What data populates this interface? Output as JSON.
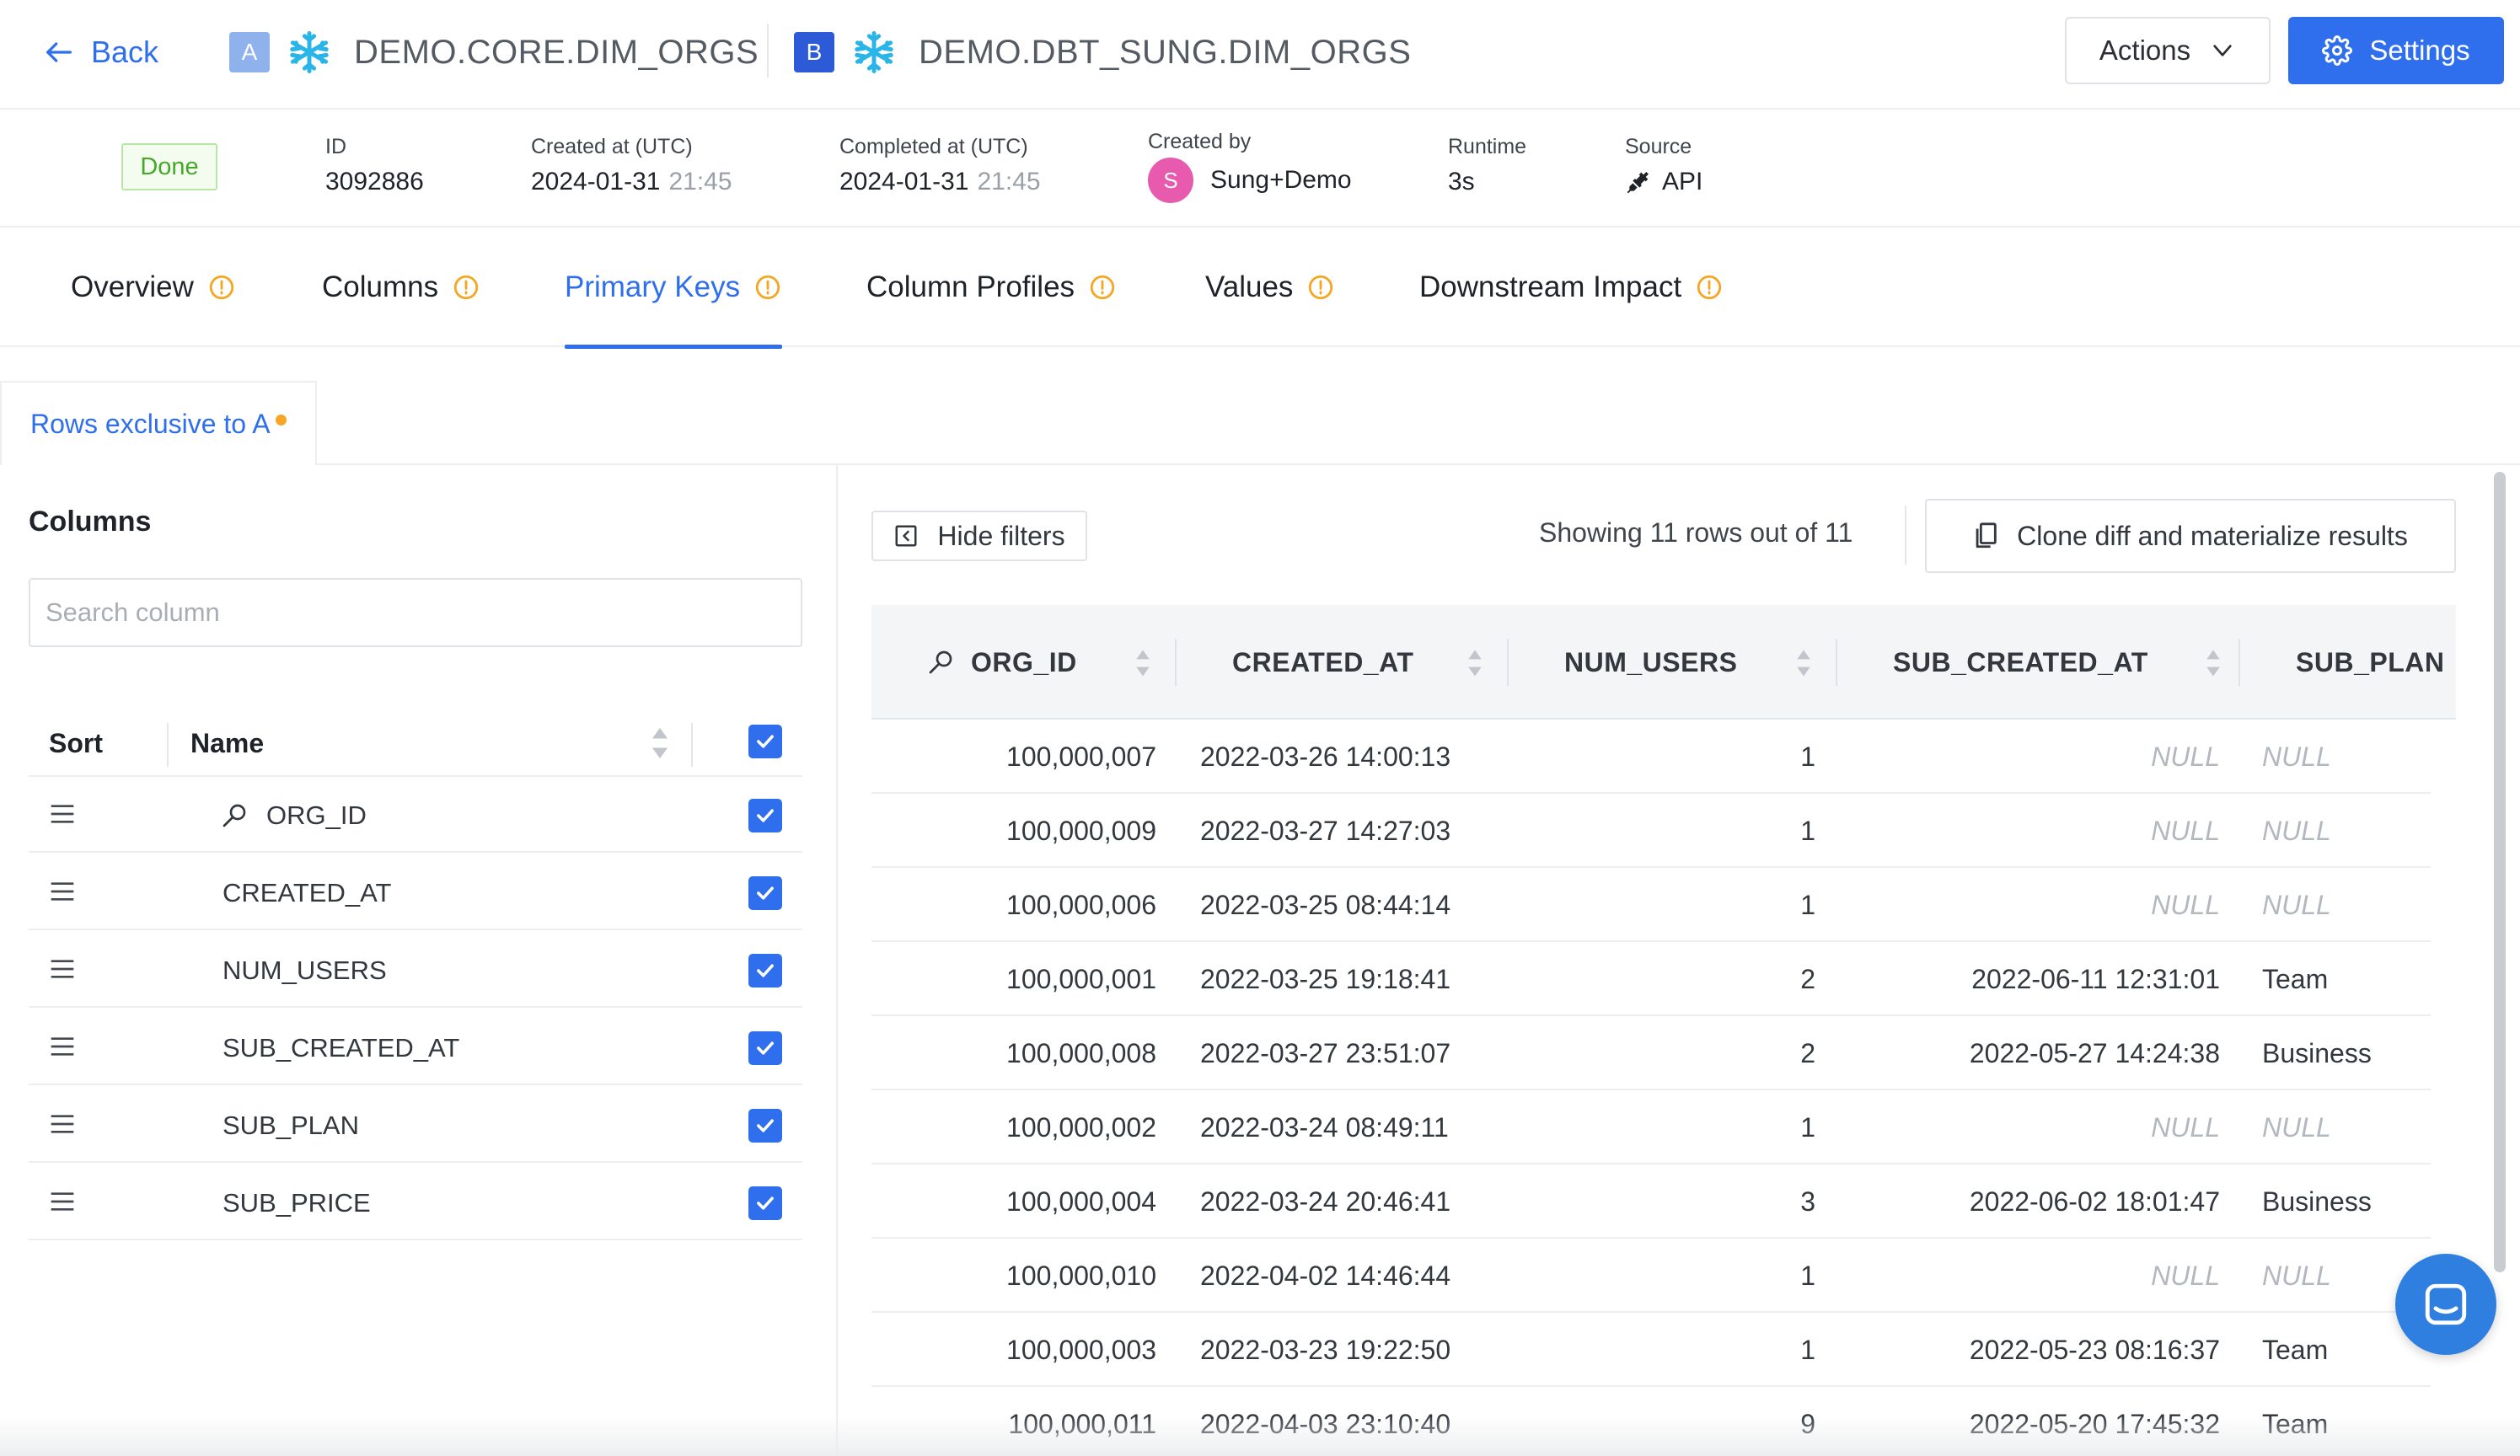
{
  "header": {
    "back_label": "Back",
    "dataset_a": {
      "badge": "A",
      "name": "DEMO.CORE.DIM_ORGS"
    },
    "dataset_b": {
      "badge": "B",
      "name": "DEMO.DBT_SUNG.DIM_ORGS"
    },
    "actions_label": "Actions",
    "settings_label": "Settings",
    "colors": {
      "accent": "#2f6fed",
      "badge_a": "#8fb1ec",
      "badge_b": "#2d5bd8",
      "snowflake": "#29b5e8"
    }
  },
  "meta": {
    "status": "Done",
    "id_label": "ID",
    "id_value": "3092886",
    "created_label": "Created at (UTC)",
    "created_date": "2024-01-31",
    "created_time": "21:45",
    "completed_label": "Completed at (UTC)",
    "completed_date": "2024-01-31",
    "completed_time": "21:45",
    "created_by_label": "Created by",
    "avatar_initial": "S",
    "created_by": "Sung+Demo",
    "runtime_label": "Runtime",
    "runtime_value": "3s",
    "source_label": "Source",
    "source_value": "API"
  },
  "tabs": [
    {
      "label": "Overview",
      "active": false
    },
    {
      "label": "Columns",
      "active": false
    },
    {
      "label": "Primary Keys",
      "active": true
    },
    {
      "label": "Column Profiles",
      "active": false
    },
    {
      "label": "Values",
      "active": false
    },
    {
      "label": "Downstream Impact",
      "active": false
    }
  ],
  "subtab": {
    "label": "Rows exclusive to A"
  },
  "columns_panel": {
    "title": "Columns",
    "search_placeholder": "Search column",
    "sort_header": "Sort",
    "name_header": "Name",
    "items": [
      {
        "name": "ORG_ID",
        "is_key": true,
        "checked": true
      },
      {
        "name": "CREATED_AT",
        "is_key": false,
        "checked": true
      },
      {
        "name": "NUM_USERS",
        "is_key": false,
        "checked": true
      },
      {
        "name": "SUB_CREATED_AT",
        "is_key": false,
        "checked": true
      },
      {
        "name": "SUB_PLAN",
        "is_key": false,
        "checked": true
      },
      {
        "name": "SUB_PRICE",
        "is_key": false,
        "checked": true
      }
    ]
  },
  "results": {
    "hide_filters_label": "Hide filters",
    "showing_text": "Showing 11 rows out of 11",
    "clone_label": "Clone diff and materialize results",
    "headers": [
      "ORG_ID",
      "CREATED_AT",
      "NUM_USERS",
      "SUB_CREATED_AT",
      "SUB_PLAN"
    ],
    "rows": [
      {
        "org_id": "100,000,007",
        "created_at": "2022-03-26 14:00:13",
        "num_users": "1",
        "sub_created_at": "NULL",
        "sub_plan": "NULL"
      },
      {
        "org_id": "100,000,009",
        "created_at": "2022-03-27 14:27:03",
        "num_users": "1",
        "sub_created_at": "NULL",
        "sub_plan": "NULL"
      },
      {
        "org_id": "100,000,006",
        "created_at": "2022-03-25 08:44:14",
        "num_users": "1",
        "sub_created_at": "NULL",
        "sub_plan": "NULL"
      },
      {
        "org_id": "100,000,001",
        "created_at": "2022-03-25 19:18:41",
        "num_users": "2",
        "sub_created_at": "2022-06-11 12:31:01",
        "sub_plan": "Team"
      },
      {
        "org_id": "100,000,008",
        "created_at": "2022-03-27 23:51:07",
        "num_users": "2",
        "sub_created_at": "2022-05-27 14:24:38",
        "sub_plan": "Business"
      },
      {
        "org_id": "100,000,002",
        "created_at": "2022-03-24 08:49:11",
        "num_users": "1",
        "sub_created_at": "NULL",
        "sub_plan": "NULL"
      },
      {
        "org_id": "100,000,004",
        "created_at": "2022-03-24 20:46:41",
        "num_users": "3",
        "sub_created_at": "2022-06-02 18:01:47",
        "sub_plan": "Business"
      },
      {
        "org_id": "100,000,010",
        "created_at": "2022-04-02 14:46:44",
        "num_users": "1",
        "sub_created_at": "NULL",
        "sub_plan": "NULL"
      },
      {
        "org_id": "100,000,003",
        "created_at": "2022-03-23 19:22:50",
        "num_users": "1",
        "sub_created_at": "2022-05-23 08:16:37",
        "sub_plan": "Team"
      },
      {
        "org_id": "100,000,011",
        "created_at": "2022-04-03 23:10:40",
        "num_users": "9",
        "sub_created_at": "2022-05-20 17:45:32",
        "sub_plan": "Team"
      }
    ]
  }
}
